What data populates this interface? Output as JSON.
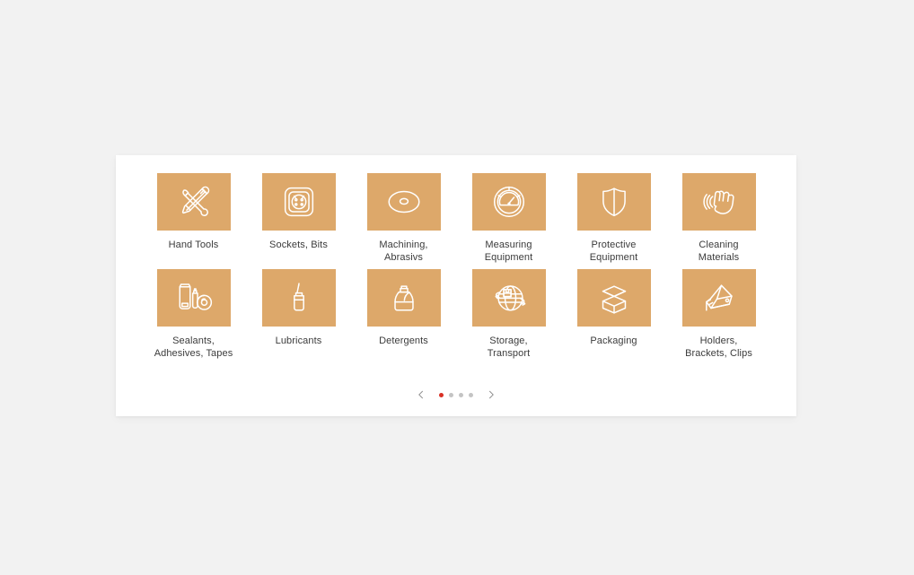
{
  "theme": {
    "page_background": "#f2f2f2",
    "card_background": "#ffffff",
    "tile_color": "#dda86a",
    "icon_color": "#ffffff",
    "label_color": "#3b3b3b",
    "dot_active_color": "#d93025",
    "dot_inactive_color": "#c4c4c4",
    "arrow_color": "#8c8c8c"
  },
  "categories": [
    {
      "label": "Hand Tools",
      "icon": "wrench-screwdriver-icon"
    },
    {
      "label": "Sockets, Bits",
      "icon": "socket-icon"
    },
    {
      "label": "Machining,\nAbrasivs",
      "icon": "grinding-disc-icon"
    },
    {
      "label": "Measuring\nEquipment",
      "icon": "gauge-icon"
    },
    {
      "label": "Protective\nEquipment",
      "icon": "shield-icon"
    },
    {
      "label": "Cleaning\nMaterials",
      "icon": "wiping-hand-icon"
    },
    {
      "label": "Sealants,\nAdhesives, Tapes",
      "icon": "tube-tape-icon"
    },
    {
      "label": "Lubricants",
      "icon": "oil-bottle-icon"
    },
    {
      "label": "Detergents",
      "icon": "canister-icon"
    },
    {
      "label": "Storage,\nTransport",
      "icon": "globe-logistics-icon"
    },
    {
      "label": "Packaging",
      "icon": "open-box-icon"
    },
    {
      "label": "Holders,\nBrackets, Clips",
      "icon": "bracket-clip-icon"
    }
  ],
  "pagination": {
    "prev_label": "chevron-left-icon",
    "next_label": "chevron-right-icon",
    "total_pages": 4,
    "active_page": 1
  }
}
